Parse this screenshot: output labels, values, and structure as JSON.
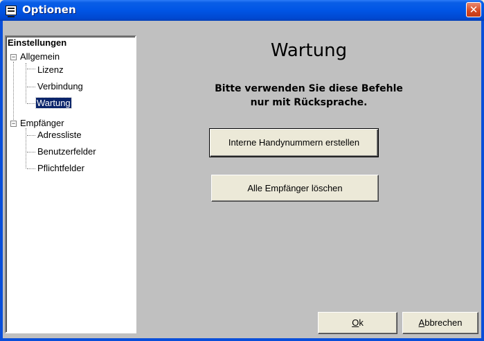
{
  "window": {
    "title": "Optionen",
    "close_label": "✕"
  },
  "tree": {
    "root": "Einstellungen",
    "groups": [
      {
        "label": "Allgemein",
        "expander": "−",
        "items": [
          {
            "label": "Lizenz"
          },
          {
            "label": "Verbindung"
          },
          {
            "label": "Wartung",
            "selected": true
          }
        ]
      },
      {
        "label": "Empfänger",
        "expander": "−",
        "items": [
          {
            "label": "Adressliste"
          },
          {
            "label": "Benutzerfelder"
          },
          {
            "label": "Pflichtfelder"
          }
        ]
      }
    ]
  },
  "content": {
    "heading": "Wartung",
    "message_line1": "Bitte verwenden Sie diese Befehle",
    "message_line2": "nur mit Rücksprache.",
    "button_handy": "Interne Handynummern erstellen",
    "button_loeschen": "Alle Empfänger löschen"
  },
  "footer": {
    "ok_accel": "O",
    "ok_rest": "k",
    "cancel_accel": "A",
    "cancel_rest": "bbrechen"
  }
}
